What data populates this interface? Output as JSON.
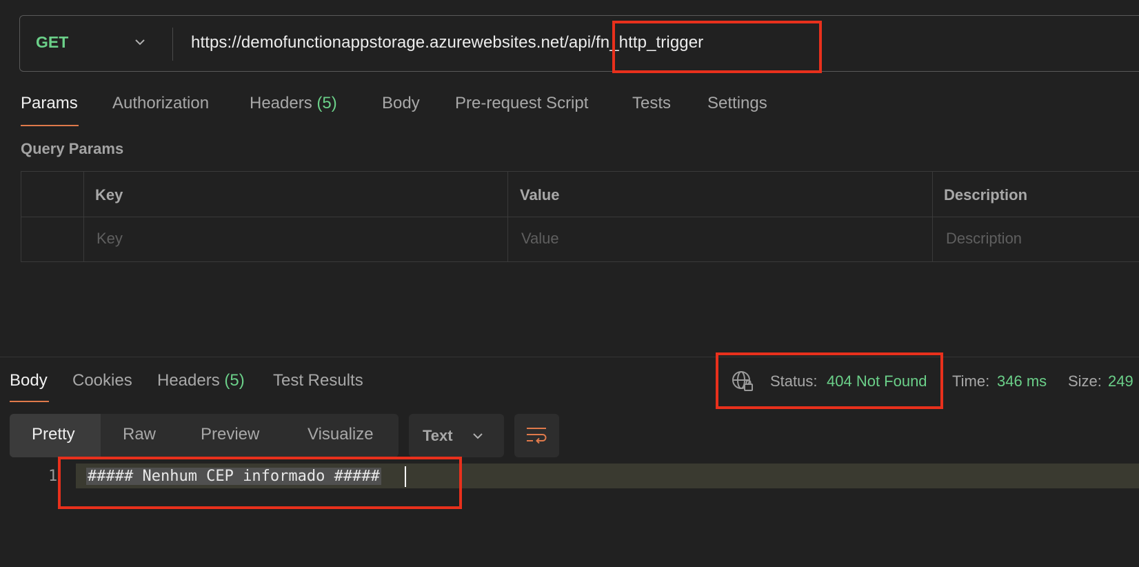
{
  "request": {
    "method": "GET",
    "url": "https://demofunctionappstorage.azurewebsites.net/api/fn_http_trigger"
  },
  "request_tabs": [
    {
      "label": "Params"
    },
    {
      "label": "Authorization"
    },
    {
      "label": "Headers",
      "count": "(5)"
    },
    {
      "label": "Body"
    },
    {
      "label": "Pre-request Script"
    },
    {
      "label": "Tests"
    },
    {
      "label": "Settings"
    }
  ],
  "query_params": {
    "title": "Query Params",
    "headers": [
      "Key",
      "Value",
      "Description"
    ],
    "placeholders": [
      "Key",
      "Value",
      "Description"
    ]
  },
  "response_tabs": [
    {
      "label": "Body"
    },
    {
      "label": "Cookies"
    },
    {
      "label": "Headers",
      "count": "(5)"
    },
    {
      "label": "Test Results"
    }
  ],
  "status": {
    "status_label": "Status:",
    "status_value": "404 Not Found",
    "time_label": "Time:",
    "time_value": "346 ms",
    "size_label": "Size:",
    "size_value": "249"
  },
  "format_modes": [
    "Pretty",
    "Raw",
    "Preview",
    "Visualize"
  ],
  "body_format": "Text",
  "response_body": {
    "line_number": "1",
    "text": "##### Nenhum CEP informado #####"
  },
  "colors": {
    "accent_green": "#6bd089",
    "accent_orange": "#e07a4b",
    "highlight_red": "#e8301c",
    "background": "#212121"
  },
  "icons": [
    "chevron-down-icon",
    "globe-lock-icon",
    "wrap-lines-icon"
  ]
}
